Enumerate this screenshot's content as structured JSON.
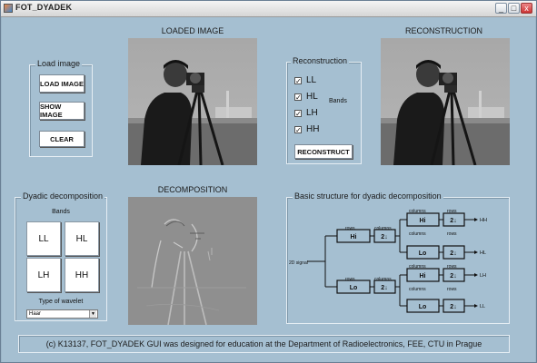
{
  "window": {
    "title": "FOT_DYADEK",
    "min_label": "_",
    "max_label": "□",
    "close_label": "x"
  },
  "headings": {
    "loaded": "LOADED IMAGE",
    "reconstruction": "RECONSTRUCTION",
    "decomposition": "DECOMPOSITION"
  },
  "load_panel": {
    "title": "Load image",
    "load_label": "LOAD IMAGE",
    "show_label": "SHOW IMAGE",
    "clear_label": "CLEAR"
  },
  "recon_panel": {
    "title": "Reconstruction",
    "bands_label": "Bands",
    "bands": [
      {
        "label": "LL",
        "checked": true
      },
      {
        "label": "HL",
        "checked": true
      },
      {
        "label": "LH",
        "checked": true
      },
      {
        "label": "HH",
        "checked": true
      }
    ],
    "reconstruct_label": "RECONSTRUCT"
  },
  "dyadic_panel": {
    "title": "Dyadic decomposition",
    "bands_label": "Bands",
    "buttons": [
      "LL",
      "HL",
      "LH",
      "HH"
    ],
    "wavelet_label": "Type of wavelet",
    "wavelet_value": "Haar"
  },
  "structure_panel": {
    "title": "Basic structure for dyadic decomposition",
    "input_label": "2D signal",
    "rows_label": "rows",
    "columns_label": "columns",
    "hi": "Hi",
    "lo": "Lo",
    "down": "2↓",
    "outputs": [
      "HH",
      "HL",
      "LH",
      "LL"
    ]
  },
  "credit": "(c) K13137, FOT_DYADEK GUI was designed for education at the Department of Radioelectronics, FEE, CTU in Prague"
}
